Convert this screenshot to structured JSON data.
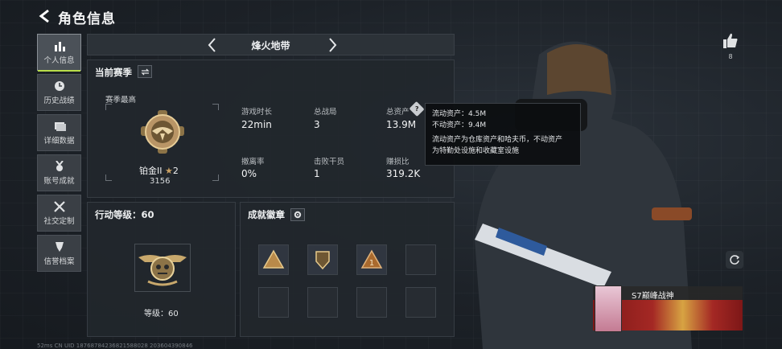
{
  "header": {
    "title": "角色信息"
  },
  "sidebar": {
    "items": [
      {
        "label": "个人信息",
        "icon": "bar-chart-icon",
        "active": true
      },
      {
        "label": "历史战绩",
        "icon": "clock-icon",
        "active": false
      },
      {
        "label": "详细数据",
        "icon": "folder-icon",
        "active": false
      },
      {
        "label": "账号成就",
        "icon": "medal-icon",
        "active": false
      },
      {
        "label": "社交定制",
        "icon": "tools-icon",
        "active": false
      },
      {
        "label": "信誉档案",
        "icon": "shield-icon",
        "active": false
      }
    ]
  },
  "selector": {
    "label": "烽火地带"
  },
  "season": {
    "title": "当前赛季",
    "best_label": "赛季最高",
    "rank_name": "铂金II",
    "rank_stars": "2",
    "rank_score": "3156",
    "stats": [
      {
        "label": "游戏时长",
        "value": "22min"
      },
      {
        "label": "总战局",
        "value": "3"
      },
      {
        "label": "总资产",
        "value": "13.9M"
      },
      {
        "label": "撤离率",
        "value": "0%"
      },
      {
        "label": "击败干员",
        "value": "1"
      },
      {
        "label": "赚损比",
        "value": "319.2K"
      }
    ]
  },
  "tooltip": {
    "line1": "流动资产：4.5M",
    "line2": "不动资产：9.4M",
    "line3": "流动资产为仓库资产和哈夫币，不动资产",
    "line4": "为特勤处设施和收藏室设施"
  },
  "level_panel": {
    "title": "行动等级：60",
    "level_label": "等级：60"
  },
  "badges_panel": {
    "title": "成就徽章",
    "filled_slots": 3,
    "total_slots": 8
  },
  "right": {
    "like_count": "8",
    "season_title": "S7巅峰战神"
  },
  "footer": {
    "text": "52ms   CN UID 18768784236821588028 203604390846"
  },
  "colors": {
    "accent": "#b9dd4a",
    "panel": "#22272d",
    "gold": "#c9a063"
  }
}
